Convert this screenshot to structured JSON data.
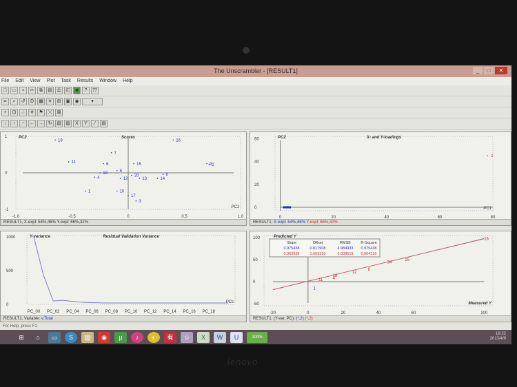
{
  "window": {
    "title": "The Unscrambler - [RESULT1]",
    "min": "_",
    "max": "□",
    "close": "✕"
  },
  "menu": [
    "File",
    "Edit",
    "View",
    "Plot",
    "Task",
    "Results",
    "Window",
    "Help"
  ],
  "toolbar_icons": [
    "new",
    "open",
    "save",
    "cut",
    "copy",
    "paste",
    "print",
    "preview",
    "model",
    "help",
    "context-help"
  ],
  "scores": {
    "title": "Scores",
    "xlabel": "PC1",
    "ylabel": "PC2",
    "xticks": [
      "-1.0",
      "-0.5",
      "0",
      "0.5",
      "1.0"
    ],
    "yticks": [
      "1",
      "0",
      "-1"
    ],
    "status": "RESULT1, X-expl: 54%,46%  Y-expl: 66%,32%"
  },
  "loadings": {
    "title": "X- and Y-loadings",
    "xlabel": "PC1",
    "ylabel": "PC2",
    "xticks": [
      "0",
      "20",
      "40",
      "60",
      "80"
    ],
    "yticks": [
      "60",
      "40",
      "20",
      "0"
    ],
    "status_prefix": "RESULT1,",
    "status_x": "X-expl: 54%,46%",
    "status_y": "Y-expl: 66%,32%"
  },
  "variance": {
    "title": "Residual Validation Variance",
    "ylabel": "Y-variance",
    "xlabel": "PCs",
    "yticks": [
      "1000",
      "500",
      "0"
    ],
    "xticks": [
      "PC_00",
      "PC_02",
      "PC_04",
      "PC_06",
      "PC_08",
      "PC_10",
      "PC_12",
      "PC_14",
      "PC_16",
      "PC_18"
    ],
    "status_prefix": "RESULT1, Variable:",
    "status_var": "v.Total"
  },
  "predicted": {
    "title": "Predicted Y",
    "xlabel": "Measured Y",
    "xticks": [
      "-20",
      "0",
      "20",
      "40",
      "60",
      "100"
    ],
    "yticks": [
      "100",
      "50",
      "0",
      "-50"
    ],
    "headers": [
      "Slope",
      "Offset",
      "RMSE",
      "R-Square"
    ],
    "cal": [
      "0.975438",
      "0.817908",
      "4.984933",
      "0.975438"
    ],
    "val": [
      "0.963939",
      "1.063393",
      "6.008519",
      "0.964316"
    ],
    "status_prefix": "RESULT1, (Y-var, PC):",
    "status_cal": "(*,2)",
    "status_val": "(*,2)"
  },
  "statusbar": "For Help, press F1",
  "tray": {
    "time": "18:22",
    "date": "2013/4/9",
    "battery": "100%"
  },
  "brand": "lenovo",
  "chart_data": [
    {
      "type": "scatter",
      "title": "Scores",
      "xlabel": "PC1",
      "ylabel": "PC2",
      "xlim": [
        -1,
        1
      ],
      "ylim": [
        -1,
        1
      ],
      "points": [
        {
          "label": "19",
          "x": -0.65,
          "y": 0.9
        },
        {
          "label": "16",
          "x": 0.4,
          "y": 0.9
        },
        {
          "label": "7",
          "x": -0.15,
          "y": 0.55
        },
        {
          "label": "11",
          "x": -0.53,
          "y": 0.3
        },
        {
          "label": "6",
          "x": -0.22,
          "y": 0.25
        },
        {
          "label": "15",
          "x": 0.05,
          "y": 0.25
        },
        {
          "label": "9",
          "x": 0.7,
          "y": 0.25
        },
        {
          "label": "2",
          "x": 0.72,
          "y": 0.23
        },
        {
          "label": "5",
          "x": -0.1,
          "y": 0.06
        },
        {
          "label": "18",
          "x": -0.25,
          "y": 0
        },
        {
          "label": "4",
          "x": -0.3,
          "y": -0.12
        },
        {
          "label": "12",
          "x": -0.07,
          "y": -0.15
        },
        {
          "label": "20",
          "x": 0.03,
          "y": -0.07
        },
        {
          "label": "13",
          "x": 0.1,
          "y": -0.15
        },
        {
          "label": "8",
          "x": 0.31,
          "y": -0.04
        },
        {
          "label": "14",
          "x": 0.26,
          "y": -0.15
        },
        {
          "label": "1",
          "x": -0.38,
          "y": -0.5
        },
        {
          "label": "10",
          "x": -0.1,
          "y": -0.5
        },
        {
          "label": "17",
          "x": 0,
          "y": -0.62
        },
        {
          "label": "3",
          "x": 0.07,
          "y": -0.77
        }
      ]
    },
    {
      "type": "scatter",
      "title": "X- and Y-loadings",
      "xlabel": "PC1",
      "ylabel": "PC2",
      "xlim": [
        -2,
        80
      ],
      "ylim": [
        -3,
        62
      ],
      "y_points": [
        {
          "label": "1",
          "x": 78,
          "y": 45
        }
      ],
      "x_points_cluster": {
        "x": [
          1,
          4
        ],
        "y": 0
      }
    },
    {
      "type": "line",
      "title": "Residual Validation Variance",
      "ylabel": "Y-variance",
      "xlabel": "PCs",
      "ylim": [
        0,
        1000
      ],
      "x": [
        0,
        1,
        2,
        3,
        4,
        5,
        6,
        7,
        8,
        9,
        10,
        11,
        12,
        13,
        14,
        15,
        16,
        17,
        18,
        19,
        20
      ],
      "values": [
        1000,
        430,
        50,
        60,
        45,
        30,
        25,
        22,
        20,
        20,
        20,
        20,
        20,
        20,
        20,
        20,
        20,
        20,
        20,
        20,
        20
      ]
    },
    {
      "type": "scatter",
      "title": "Predicted Y",
      "xlim": [
        -25,
        105
      ],
      "ylim": [
        -55,
        105
      ],
      "points": [
        {
          "label": "1",
          "x": 3,
          "y": -15
        },
        {
          "label": "11",
          "x": 6,
          "y": 5
        },
        {
          "label": "4",
          "x": 14,
          "y": 8
        },
        {
          "label": "18",
          "x": 14,
          "y": 14
        },
        {
          "label": "12",
          "x": 25,
          "y": 22
        },
        {
          "label": "6",
          "x": 34,
          "y": 28
        },
        {
          "label": "34",
          "x": 45,
          "y": 45
        },
        {
          "label": "15",
          "x": 55,
          "y": 50
        },
        {
          "label": "16",
          "x": 100,
          "y": 98
        }
      ],
      "lines": [
        {
          "name": "calibration",
          "slope": 0.975438,
          "offset": 0.817908
        },
        {
          "name": "validation",
          "slope": 0.963939,
          "offset": 1.063393
        }
      ]
    }
  ]
}
